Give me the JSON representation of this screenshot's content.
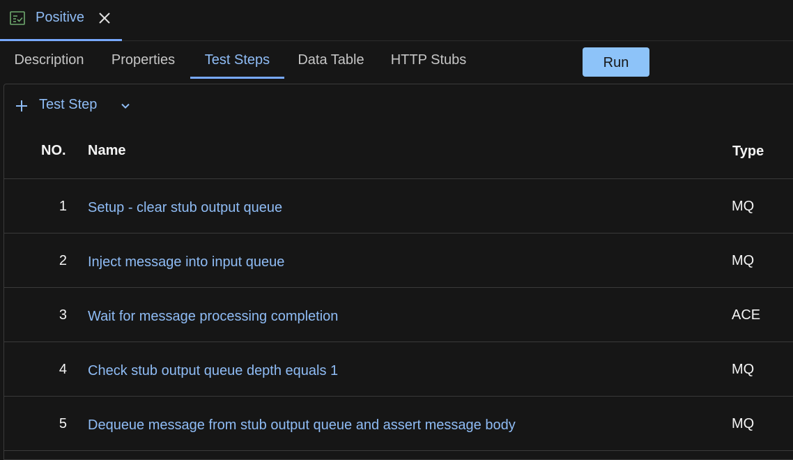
{
  "editor_tab": {
    "label": "Positive",
    "icon": "test-case-icon",
    "close_icon": "close-icon",
    "accent_color": "#78a9ff"
  },
  "subtabs": [
    {
      "label": "Description",
      "active": false
    },
    {
      "label": "Properties",
      "active": false
    },
    {
      "label": "Test Steps",
      "active": true
    },
    {
      "label": "Data Table",
      "active": false
    },
    {
      "label": "HTTP Stubs",
      "active": false
    }
  ],
  "run_button": {
    "label": "Run",
    "color": "#8dc3f9"
  },
  "toolbar": {
    "add_step_label": "Test Step",
    "add_icon": "plus-icon",
    "dropdown_icon": "chevron-down-icon"
  },
  "table": {
    "headers": {
      "no": "NO.",
      "name": "Name",
      "type": "Type"
    },
    "rows": [
      {
        "no": "1",
        "name": "Setup - clear stub output queue",
        "type": "MQ"
      },
      {
        "no": "2",
        "name": "Inject message into input queue",
        "type": "MQ"
      },
      {
        "no": "3",
        "name": "Wait for message processing completion",
        "type": "ACE"
      },
      {
        "no": "4",
        "name": "Check stub output queue depth equals 1",
        "type": "MQ"
      },
      {
        "no": "5",
        "name": "Dequeue message from stub output queue and assert message body",
        "type": "MQ"
      }
    ]
  },
  "colors": {
    "background": "#161616",
    "link": "#8fbcf5",
    "border": "#3a3a3a"
  }
}
